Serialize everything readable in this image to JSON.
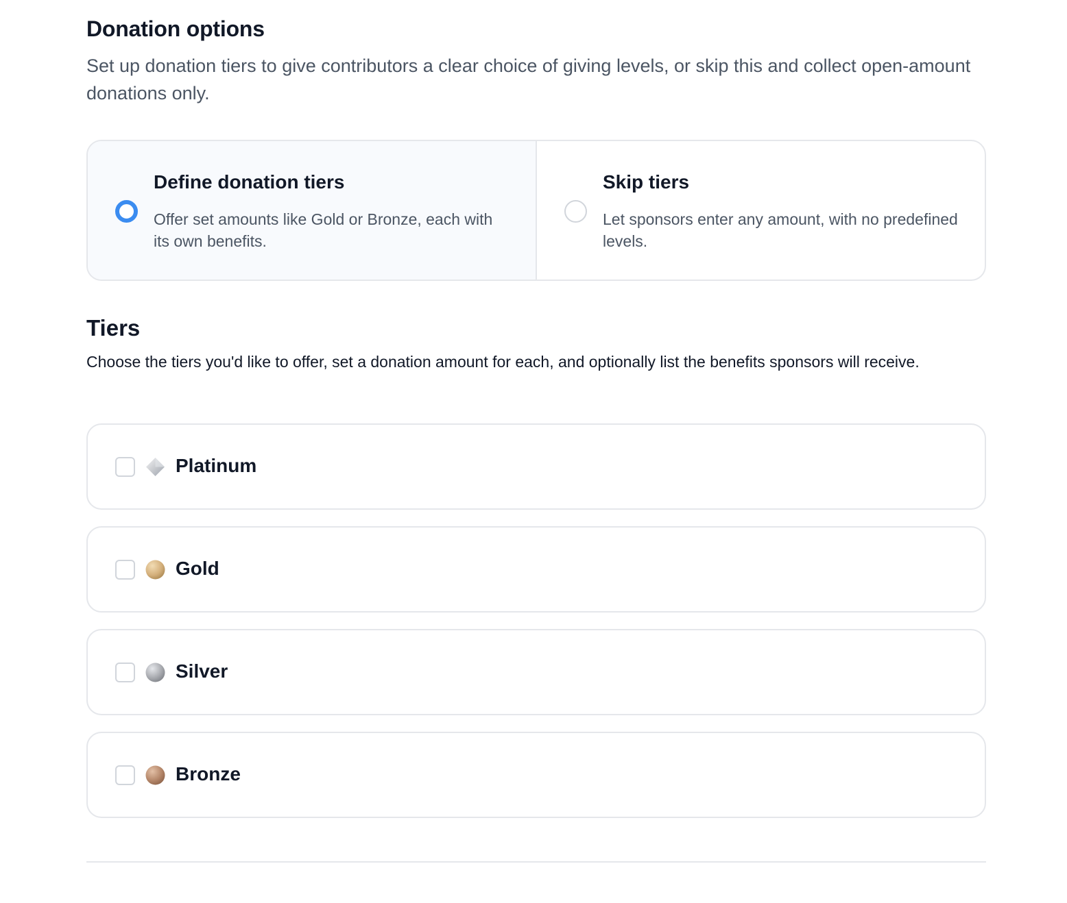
{
  "donation_options": {
    "title": "Donation options",
    "description": "Set up donation tiers to give contributors a clear choice of giving levels, or skip this and collect open-amount donations only.",
    "choices": [
      {
        "title": "Define donation tiers",
        "description": "Offer set amounts like Gold or Bronze, each with its own benefits.",
        "selected": true
      },
      {
        "title": "Skip tiers",
        "description": "Let sponsors enter any amount, with no predefined levels.",
        "selected": false
      }
    ]
  },
  "tiers": {
    "title": "Tiers",
    "description": "Choose the tiers you'd like to offer, set a donation amount for each, and optionally list the benefits sponsors will receive.",
    "items": [
      {
        "name": "Platinum",
        "icon": "platinum-diamond-icon",
        "checked": false
      },
      {
        "name": "Gold",
        "icon": "gold-medal-icon",
        "checked": false
      },
      {
        "name": "Silver",
        "icon": "silver-medal-icon",
        "checked": false
      },
      {
        "name": "Bronze",
        "icon": "bronze-medal-icon",
        "checked": false
      }
    ]
  },
  "colors": {
    "accent": "#3b8cf0",
    "border": "#e5e7eb",
    "selected_bg": "#f8fafd",
    "muted_text": "#4b5563"
  }
}
